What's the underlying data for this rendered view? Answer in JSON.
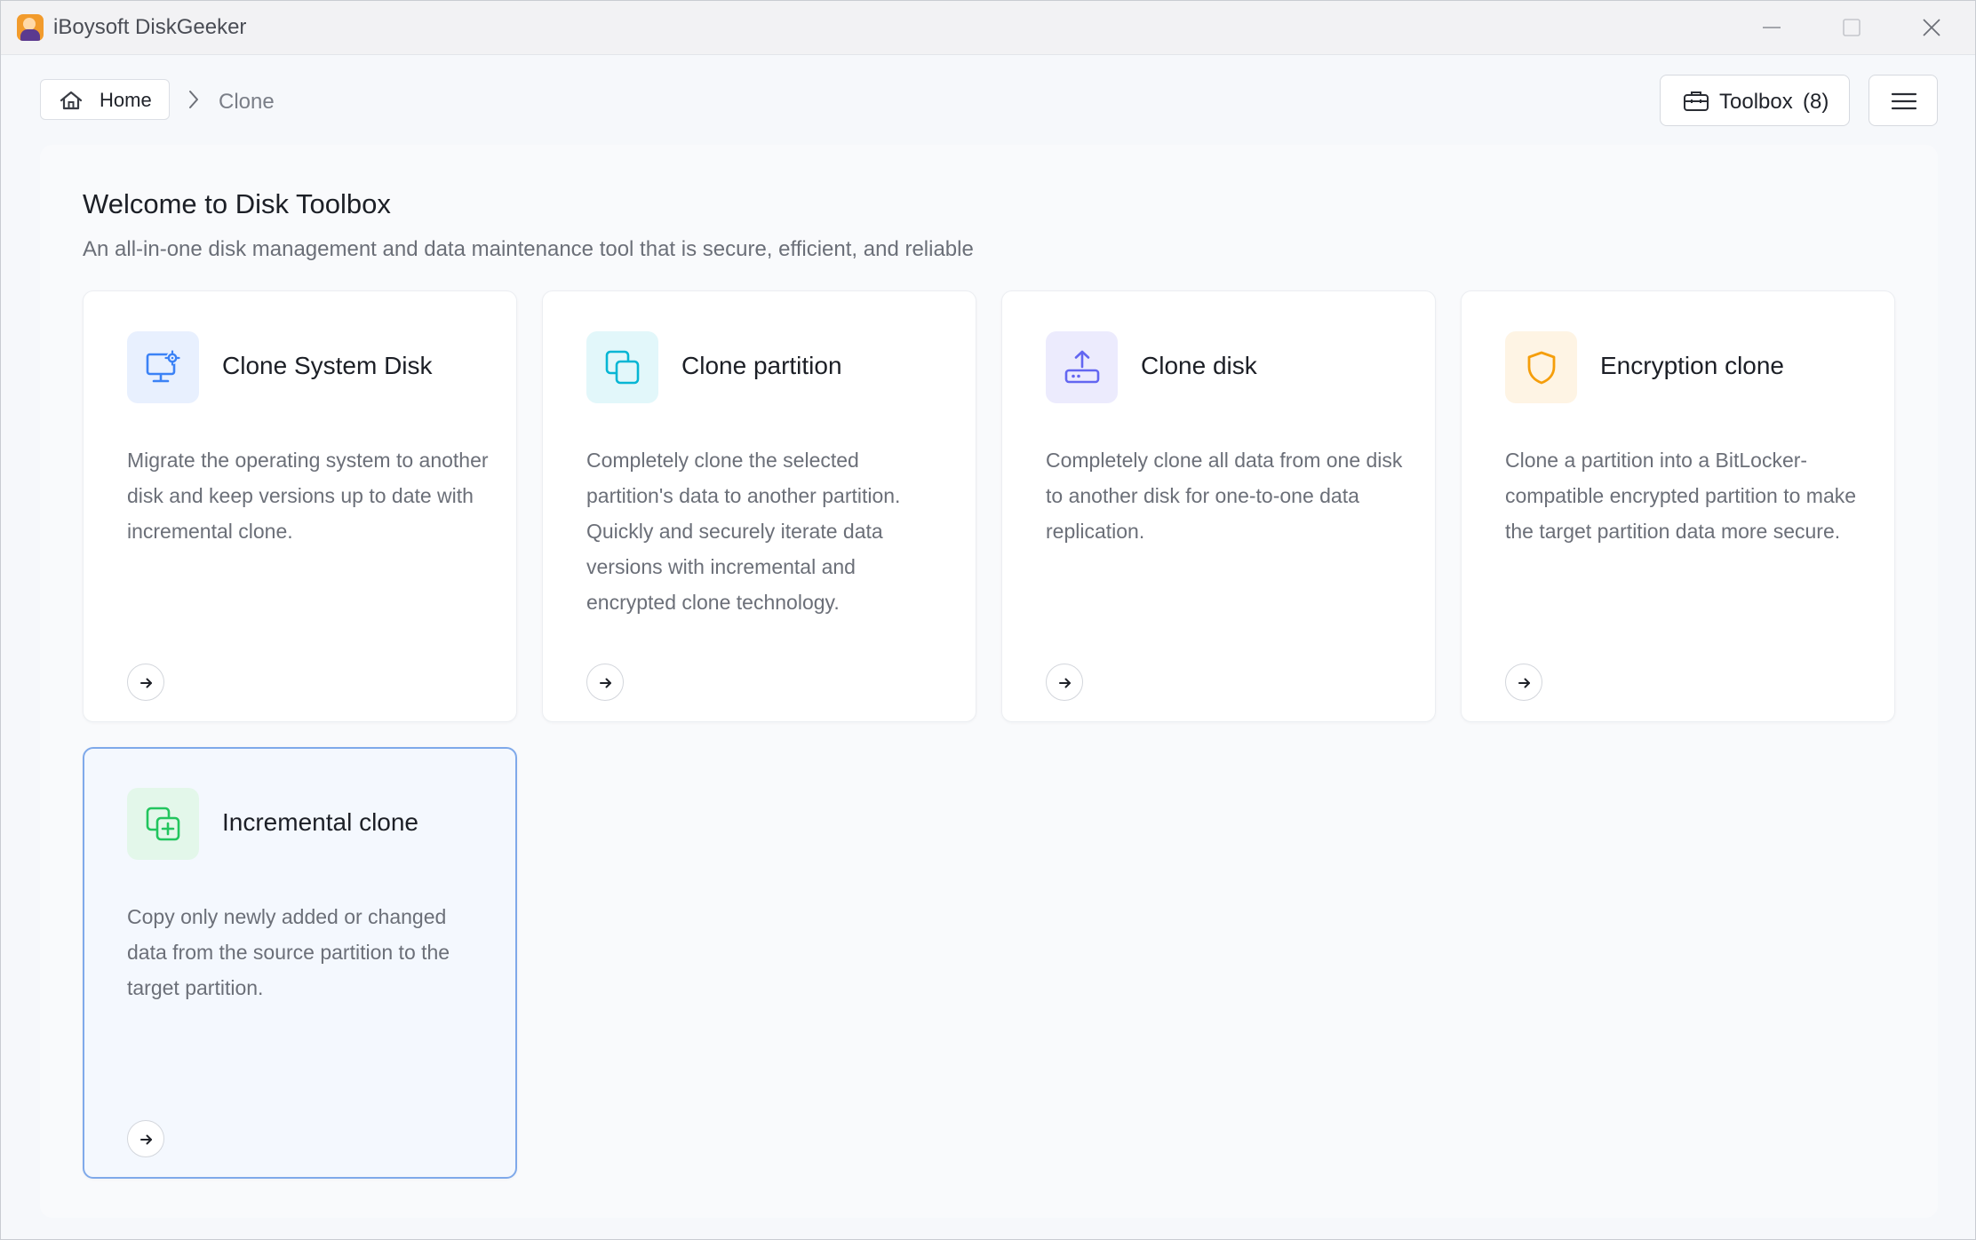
{
  "window": {
    "title": "iBoysoft DiskGeeker"
  },
  "nav": {
    "home_label": "Home",
    "current": "Clone",
    "toolbox_label": "Toolbox",
    "toolbox_count": "(8)"
  },
  "main": {
    "title": "Welcome to Disk Toolbox",
    "subtitle": "An all-in-one disk management and data maintenance tool that is secure, efficient, and reliable"
  },
  "cards": [
    {
      "title": "Clone System Disk",
      "description": "Migrate the operating system to another disk and keep versions up to date with incremental clone.",
      "icon": "monitor-gear-icon",
      "color": "#3b82f6"
    },
    {
      "title": "Clone partition",
      "description": "Completely clone the selected partition's data to another partition. Quickly and securely iterate data versions with incremental and encrypted clone technology.",
      "icon": "copy-icon",
      "color": "#06b6d4"
    },
    {
      "title": "Clone disk",
      "description": "Completely clone all data from one disk to another disk for one-to-one data replication.",
      "icon": "disk-upload-icon",
      "color": "#6366f1"
    },
    {
      "title": "Encryption clone",
      "description": "Clone a partition into a BitLocker-compatible encrypted partition to make the target partition data more secure.",
      "icon": "shield-icon",
      "color": "#f59e0b"
    },
    {
      "title": "Incremental clone",
      "description": "Copy only newly added or changed data from the source partition to the target partition.",
      "icon": "copy-plus-icon",
      "color": "#22c55e"
    }
  ]
}
